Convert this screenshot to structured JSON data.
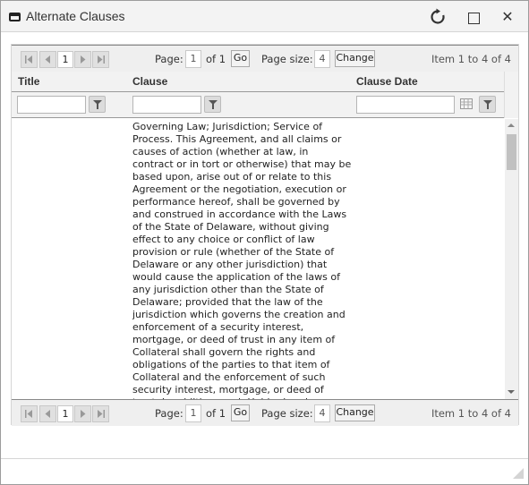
{
  "window": {
    "title": "Alternate Clauses",
    "buttons": {
      "refresh": "refresh-icon",
      "maximize": "maximize-icon",
      "close_glyph": "✕"
    }
  },
  "pager": {
    "current_page_button": "1",
    "page_label": "Page:",
    "page_value": "1",
    "of_label": "of 1",
    "go_label": "Go",
    "page_size_label": "Page size:",
    "page_size_value": "4",
    "change_label": "Change",
    "info": "Item 1 to 4 of 4"
  },
  "columns": [
    {
      "label": "Title",
      "filter_value": ""
    },
    {
      "label": "Clause",
      "filter_value": ""
    },
    {
      "label": "Clause Date",
      "filter_value": ""
    }
  ],
  "rows": [
    {
      "title": "",
      "clause": "Governing Law; Jurisdiction; Service of Process. This Agreement, and all claims or causes of action (whether at law, in contract or in tort or otherwise) that may be based upon, arise out of or relate to this Agreement or the negotiation, execution or performance hereof, shall be governed by and construed in accordance with the Laws of the State of Delaware, without giving effect to any choice or conflict of law provision or rule (whether of the State of Delaware or any other jurisdiction) that would cause the application of the laws of any jurisdiction other than the State of Delaware; provided that the law of the jurisdiction which governs the creation and enforcement of a security interest, mortgage, or deed of trust in any item of Collateral shall govern the rights and obligations of the parties to that item of Collateral and the enforcement of such security interest, mortgage, or deed of trust. In addition, each Holder hereby",
      "clause_date": ""
    }
  ],
  "scrollbar": {
    "position_fraction": 0.0
  }
}
